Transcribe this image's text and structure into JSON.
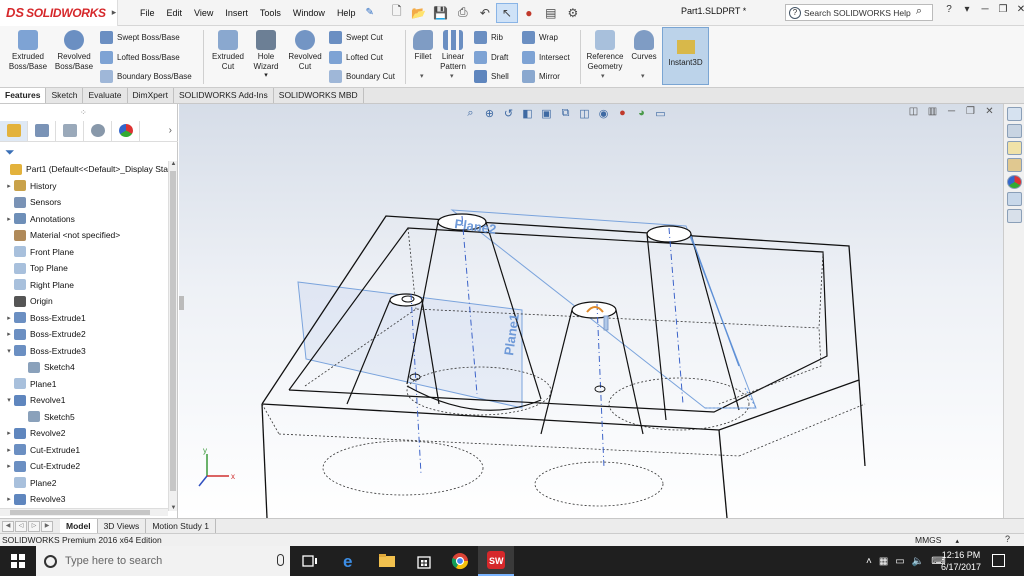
{
  "app": {
    "logo_ds": "DS",
    "logo_text": "SOLIDWORKS",
    "doc_title": "Part1.SLDPRT *",
    "help_search_placeholder": "Search SOLIDWORKS Help",
    "help_icon_label": "?"
  },
  "menu": [
    "File",
    "Edit",
    "View",
    "Insert",
    "Tools",
    "Window",
    "Help"
  ],
  "commands": {
    "extruded_boss": "Extruded Boss/Base",
    "revolved_boss": "Revolved Boss/Base",
    "swept_boss": "Swept Boss/Base",
    "lofted_boss": "Lofted Boss/Base",
    "boundary_boss": "Boundary Boss/Base",
    "extruded_cut": "Extruded Cut",
    "hole_wizard": "Hole Wizard",
    "revolved_cut": "Revolved Cut",
    "swept_cut": "Swept Cut",
    "lofted_cut": "Lofted Cut",
    "boundary_cut": "Boundary Cut",
    "fillet": "Fillet",
    "linear_pattern": "Linear Pattern",
    "rib": "Rib",
    "draft": "Draft",
    "shell": "Shell",
    "wrap": "Wrap",
    "intersect": "Intersect",
    "mirror": "Mirror",
    "reference_geometry": "Reference Geometry",
    "curves": "Curves",
    "instant3d": "Instant3D"
  },
  "tabs": [
    "Features",
    "Sketch",
    "Evaluate",
    "DimXpert",
    "SOLIDWORKS Add-Ins",
    "SOLIDWORKS MBD"
  ],
  "tree": {
    "root": "Part1  (Default<<Default>_Display Sta",
    "items": [
      {
        "label": "History",
        "expand": "▸",
        "color": "#c9a24a"
      },
      {
        "label": "Sensors",
        "expand": "",
        "color": "#7a93b6"
      },
      {
        "label": "Annotations",
        "expand": "▸",
        "color": "#6e8fb8"
      },
      {
        "label": "Material <not specified>",
        "expand": "",
        "color": "#b08a5a"
      },
      {
        "label": "Front Plane",
        "expand": "",
        "color": "#a8c0dc"
      },
      {
        "label": "Top Plane",
        "expand": "",
        "color": "#a8c0dc"
      },
      {
        "label": "Right Plane",
        "expand": "",
        "color": "#a8c0dc"
      },
      {
        "label": "Origin",
        "expand": "",
        "color": "#555555"
      },
      {
        "label": "Boss-Extrude1",
        "expand": "▸",
        "color": "#6b8fc2"
      },
      {
        "label": "Boss-Extrude2",
        "expand": "▸",
        "color": "#6b8fc2"
      },
      {
        "label": "Boss-Extrude3",
        "expand": "▾",
        "color": "#6b8fc2"
      },
      {
        "label": "Sketch4",
        "expand": "",
        "color": "#8aa1bb",
        "indent": 1
      },
      {
        "label": "Plane1",
        "expand": "",
        "color": "#a8c0dc"
      },
      {
        "label": "Revolve1",
        "expand": "▾",
        "color": "#5f86be"
      },
      {
        "label": "Sketch5",
        "expand": "",
        "color": "#8aa1bb",
        "indent": 1
      },
      {
        "label": "Revolve2",
        "expand": "▸",
        "color": "#5f86be"
      },
      {
        "label": "Cut-Extrude1",
        "expand": "▸",
        "color": "#6b8fc2"
      },
      {
        "label": "Cut-Extrude2",
        "expand": "▸",
        "color": "#6b8fc2"
      },
      {
        "label": "Plane2",
        "expand": "",
        "color": "#a8c0dc"
      },
      {
        "label": "Revolve3",
        "expand": "▸",
        "color": "#5f86be"
      }
    ]
  },
  "viewport": {
    "plane1_label": "Plane1",
    "plane2_label": "Plane2",
    "triad_x": "x",
    "triad_y": "y"
  },
  "bottom_tabs": [
    "Model",
    "3D Views",
    "Motion Study 1"
  ],
  "status": {
    "edition": "SOLIDWORKS Premium 2016 x64 Edition",
    "units": "MMGS",
    "units_caret": "▴",
    "help": "?"
  },
  "taskbar": {
    "search_placeholder": "Type here to search",
    "time": "12:16 PM",
    "date": "6/17/2017"
  },
  "colors": {
    "brand_red": "#d6282b",
    "accent_blue": "#2b6cc4",
    "plane_blue": "#5d8fd6"
  }
}
